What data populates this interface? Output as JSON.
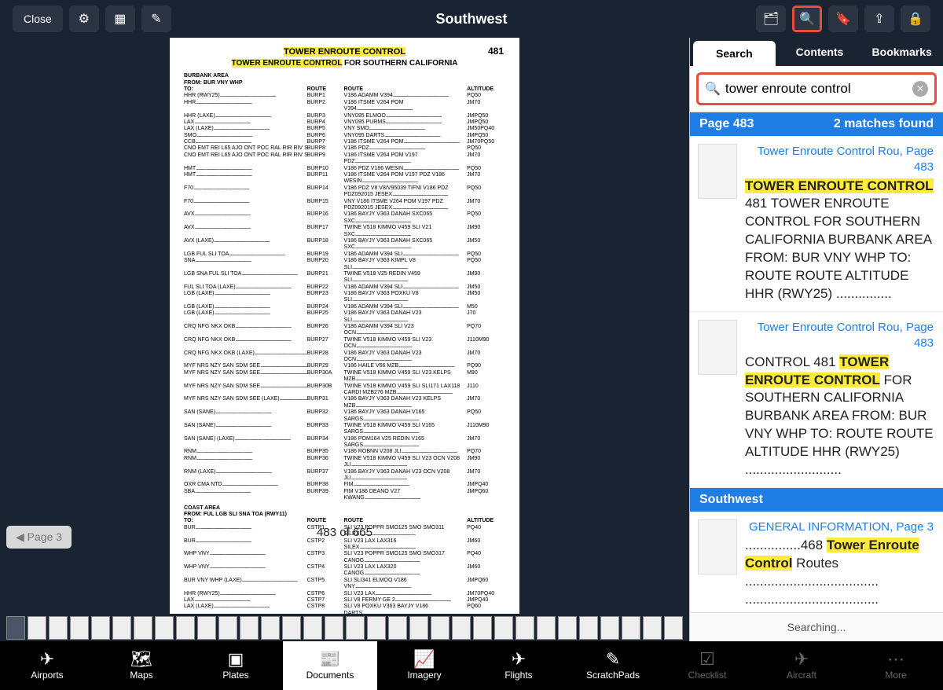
{
  "header": {
    "title": "Southwest",
    "close_label": "Close"
  },
  "doc": {
    "page_number_top": "481",
    "title1": "TOWER ENROUTE CONTROL",
    "title2_hl": "TOWER ENROUTE CONTROL",
    "title2_rest": " FOR SOUTHERN CALIFORNIA",
    "section1_area": "BURBANK AREA",
    "section1_from": "FROM: BUR VNY WHP",
    "to_label": "TO:",
    "col_route": "ROUTE",
    "col_alt": "ALTITUDE",
    "rows1": [
      {
        "t": "HHR (RWY25)",
        "r1": "BURP1",
        "r2": "V186 ADAMM V394",
        "a": "PQ50"
      },
      {
        "t": "HHR",
        "r1": "BURP2",
        "r2": "V186 ITSME V264 POM V394",
        "a": "JM70"
      },
      {
        "t": "HHR (LAXE)",
        "r1": "BURP3",
        "r2": "VNY095 ELMOO",
        "a": "JMPQ50"
      },
      {
        "t": "LAX",
        "r1": "BURP4",
        "r2": "VNY095 PURMS",
        "a": "JMPQ50"
      },
      {
        "t": "LAX (LAXE)",
        "r1": "BURP5",
        "r2": "VNY SMO",
        "a": "JM50PQ40"
      },
      {
        "t": "SMO",
        "r1": "BURP6",
        "r2": "VNY095 DARTS",
        "a": "JMPQ50"
      },
      {
        "t": "CCB",
        "r1": "BURP7",
        "r2": "V186 ITSME V264 POM",
        "a": "JM70PQ50"
      },
      {
        "t": "CNO EMT REI L65 AJO ONT POC RAL RIR RIV SBD",
        "r1": "BURP8",
        "r2": "V186 PDZ",
        "a": "PQ50"
      },
      {
        "t": "CNO EMT REI L65 AJO ONT POC RAL RIR RIV SBD",
        "r1": "BURP9",
        "r2": "V186 ITSME V264 POM V197 PDZ",
        "a": "JM70"
      },
      {
        "t": "HMT",
        "r1": "BURP10",
        "r2": "V186 PDZ V186 WESIN",
        "a": "PQ50"
      },
      {
        "t": "HMT",
        "r1": "BURP11",
        "r2": "V186 ITSME V264 POM V197 PDZ V186 WESIN",
        "a": "JM70"
      },
      {
        "t": "F70",
        "r1": "BURP14",
        "r2": "V186 PDZ V8 V8/V95039 TIFNI V186 PDZ PDZ092015 JESEX",
        "a": "PQ50"
      },
      {
        "t": "F70",
        "r1": "BURP15",
        "r2": "VNY V186 ITSME V264 POM V197 PDZ PDZ092015 JESEX",
        "a": "JM70"
      },
      {
        "t": "AVX",
        "r1": "BURP16",
        "r2": "V186 BAYJY V363 DANAH SXC065 SXC",
        "a": "PQ50"
      },
      {
        "t": "AVX",
        "r1": "BURP17",
        "r2": "TWINE V518 KIMMO V459 SLI V21 SXC",
        "a": "JM90"
      },
      {
        "t": "AVX (LAXE)",
        "r1": "BURP18",
        "r2": "V186 BAYJY V363 DANAH SXC065 SXC",
        "a": "JM50"
      },
      {
        "t": "LGB FUL SLI TOA",
        "r1": "BURP19",
        "r2": "V186 ADAMM V394 SLI",
        "a": "PQ50"
      },
      {
        "t": "SNA",
        "r1": "BURP20",
        "r2": "V186 BAYJY V363 KIMPL V8 SLI",
        "a": "PQ50"
      },
      {
        "t": "LGB SNA FUL SLI TOA",
        "r1": "BURP21",
        "r2": "TWINE V518 V25 REDIN V459 SLI",
        "a": "JM90"
      },
      {
        "t": "FUL SLI TOA (LAXE)",
        "r1": "BURP22",
        "r2": "V186 ADAMM V394 SLI",
        "a": "JM50"
      },
      {
        "t": "LGB (LAXE)",
        "r1": "BURP23",
        "r2": "V186 BAYJY V363 POXKU V8 SLI",
        "a": "JM50"
      },
      {
        "t": "LGB (LAXE)",
        "r1": "BURP24",
        "r2": "V186 ADAMM V394 SLI",
        "a": "M50"
      },
      {
        "t": "LGB (LAXE)",
        "r1": "BURP25",
        "r2": "V186 BAYJY V363 DANAH V23 SLI",
        "a": "J70"
      },
      {
        "t": "CRQ NFG NKX OKB",
        "r1": "BURP26",
        "r2": "V186 ADAMM V394 SLI V23 OCN",
        "a": "PQ70"
      },
      {
        "t": "CRQ NFG NKX OKB",
        "r1": "BURP27",
        "r2": "TWINE V518 KIMMO V459 SLI V23 OCN",
        "a": "J110M90"
      },
      {
        "t": "CRQ NFG NKX OKB (LAXE)",
        "r1": "BURP28",
        "r2": "V186 BAYJY V363 DANAH V23 OCN",
        "a": "JM70"
      },
      {
        "t": "MYF NRS NZY SAN SDM SEE",
        "r1": "BURP29",
        "r2": "V186 HAILE V66 MZB",
        "a": "PQ90"
      },
      {
        "t": "MYF NRS NZY SAN SDM SEE",
        "r1": "BURP30A",
        "r2": "TWINE V518 KIMMO V459 SLI V23 KELPS MZB",
        "a": "M90"
      },
      {
        "t": "MYF NRS NZY SAN SDM SEE",
        "r1": "BURP30B",
        "r2": "TWINE V518 KIMMO V459 SLI SLI171 LAX118 CARDI MZB276 MZB",
        "a": "J110"
      },
      {
        "t": "MYF NRS NZY SAN SDM SEE (LAXE)",
        "r1": "BURP31",
        "r2": "V186 BAYJY V363 DANAH V23 KELPS MZB",
        "a": "JM70"
      },
      {
        "t": "SAN (SANE)",
        "r1": "BURP32",
        "r2": "V186 BAYJY V363 DANAH V165 SARGS",
        "a": "PQ50"
      },
      {
        "t": "SAN (SANE)",
        "r1": "BURP33",
        "r2": "TWINE V518 KIMMO V459 SLI V165 SARGS",
        "a": "J110M90"
      },
      {
        "t": "SAN (SANE) (LAXE)",
        "r1": "BURP34",
        "r2": "V186 POM164 V25 REDIN V165 SARGS",
        "a": "JM70"
      },
      {
        "t": "RNM",
        "r1": "BURP35",
        "r2": "V186 ROBNN V208 JLI",
        "a": "PQ70"
      },
      {
        "t": "RNM",
        "r1": "BURP36",
        "r2": "TWINE V518 KIMMO V459 SLI V23 OCN V208 JLI",
        "a": "JM90"
      },
      {
        "t": "RNM (LAXE)",
        "r1": "BURP37",
        "r2": "V186 BAYJY V363 DANAH V23 OCN V208 JLI",
        "a": "JM70"
      },
      {
        "t": "OXR CMA NTD",
        "r1": "BURP38",
        "r2": "FIM",
        "a": "JMPQ40"
      },
      {
        "t": "SBA",
        "r1": "BURP39",
        "r2": "FIM V186 DEANO V27 KWANG",
        "a": "JMPQ60"
      }
    ],
    "section2_area": "COAST AREA",
    "section2_from": "FROM: FUL LGB SLI SNA TOA (RWY11)",
    "rows2": [
      {
        "t": "BUR",
        "r1": "CSTP1",
        "r2": "SLI V23 POPPR SMO125 SMO SMO311 SILEX",
        "a": "PQ40"
      },
      {
        "t": "BUR",
        "r1": "CSTP2",
        "r2": "SLI V23 LAX LAX316 SILEX",
        "a": "JM60"
      },
      {
        "t": "WHP VNY",
        "r1": "CSTP3",
        "r2": "SLI V23 POPPR SMO125 SMO SMO317 CANOG",
        "a": "PQ40"
      },
      {
        "t": "WHP VNY",
        "r1": "CSTP4",
        "r2": "SLI V23 LAX LAX320 CANOG",
        "a": "JM60"
      },
      {
        "t": "BUR VNY WHP (LAXE)",
        "r1": "CSTP5",
        "r2": "SLI SLI341 ELMOO V186 VNY",
        "a": "JMPQ60"
      },
      {
        "t": "HHR (RWY25)",
        "r1": "CSTP6",
        "r2": "SLI V23 LAX",
        "a": "JM70PQ40"
      },
      {
        "t": "LAX",
        "r1": "CSTP7",
        "r2": "SLI V8 FERMY GE 2",
        "a": "JMPQ40"
      },
      {
        "t": "LAX (LAXE)",
        "r1": "CSTP8",
        "r2": "SLI V8 POXKU V363 BAYJY V186 DARTS",
        "a": "PQ60"
      }
    ],
    "page_indicator": "483 of 665",
    "prev_btn": "Page 3"
  },
  "search": {
    "tabs": {
      "search": "Search",
      "contents": "Contents",
      "bookmarks": "Bookmarks"
    },
    "query": "tower enroute control",
    "header1_page": "Page 483",
    "header1_count": "2 matches found",
    "result1_link": "Tower Enroute Control Rou, Page 483",
    "result1_hl": "TOWER ENROUTE CONTROL",
    "result1_txt": " 481 TOWER ENROUTE CONTROL FOR SOUTHERN CALIFORNIA BURBANK AREA FROM: BUR VNY WHP TO: ROUTE ROUTE ALTITUDE HHR (RWY25) ...............",
    "result2_link": "Tower Enroute Control Rou, Page 483",
    "result2_pre": "CONTROL 481 ",
    "result2_hl": "TOWER ENROUTE CONTROL",
    "result2_post": " FOR SOUTHERN CALIFORNIA BURBANK AREA FROM: BUR VNY WHP TO: ROUTE ROUTE ALTITUDE HHR (RWY25) ..........................",
    "header2": "Southwest",
    "result3_link": "GENERAL INFORMATION, Page 3",
    "result3_pre": "...............468 ",
    "result3_hl": "Tower Enroute Control",
    "result3_post": " Routes .................................... .................................... ....................................",
    "searching": "Searching..."
  },
  "nav": {
    "airports": "Airports",
    "maps": "Maps",
    "plates": "Plates",
    "documents": "Documents",
    "imagery": "Imagery",
    "flights": "Flights",
    "scratchpads": "ScratchPads",
    "checklist": "Checklist",
    "aircraft": "Aircraft",
    "more": "More"
  }
}
